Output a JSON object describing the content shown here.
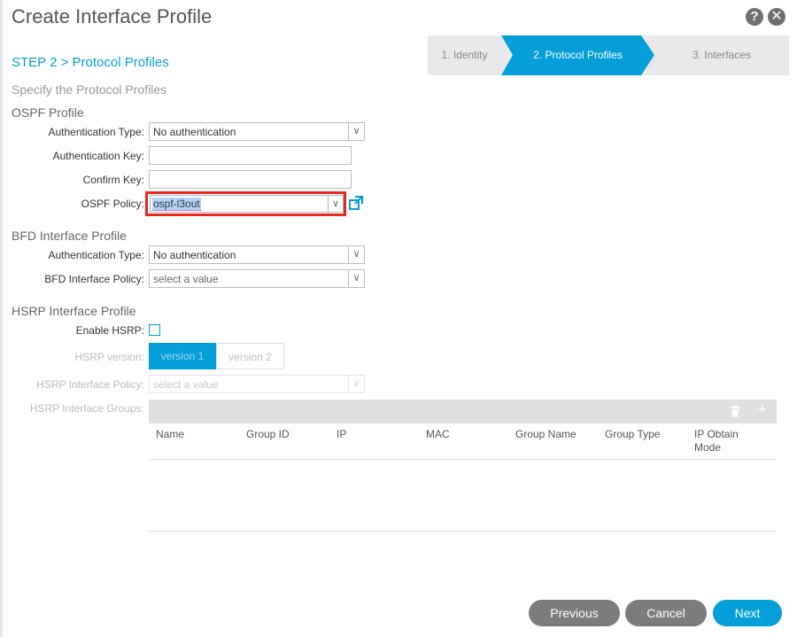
{
  "dialog": {
    "title": "Create Interface Profile",
    "help_label": "?",
    "close_label": "✕"
  },
  "wizard": {
    "steps": [
      {
        "label": "1. Identity",
        "state": "done"
      },
      {
        "label": "2. Protocol Profiles",
        "state": "active"
      },
      {
        "label": "3. Interfaces",
        "state": "pending"
      }
    ]
  },
  "step_heading": "STEP 2 > Protocol Profiles",
  "subheading": "Specify the Protocol Profiles",
  "ospf": {
    "section_title": "OSPF Profile",
    "auth_type_label": "Authentication Type:",
    "auth_type_value": "No authentication",
    "auth_key_label": "Authentication Key:",
    "auth_key_value": "",
    "confirm_key_label": "Confirm Key:",
    "confirm_key_value": "",
    "policy_label": "OSPF Policy:",
    "policy_value": "ospf-l3out"
  },
  "bfd": {
    "section_title": "BFD Interface Profile",
    "auth_type_label": "Authentication Type:",
    "auth_type_value": "No authentication",
    "policy_label": "BFD Interface Policy:",
    "policy_placeholder": "select a value"
  },
  "hsrp": {
    "section_title": "HSRP Interface Profile",
    "enable_label": "Enable HSRP:",
    "enabled": false,
    "version_label": "HSRP version:",
    "versions": [
      "version 1",
      "version 2"
    ],
    "selected_version": "version 1",
    "policy_label": "HSRP Interface Policy:",
    "policy_placeholder": "select a value",
    "groups_label": "HSRP Interface Groups:",
    "table_columns": [
      "Name",
      "Group ID",
      "IP",
      "MAC",
      "Group Name",
      "Group Type",
      "IP Obtain Mode"
    ],
    "table_rows": []
  },
  "footer": {
    "previous_label": "Previous",
    "cancel_label": "Cancel",
    "next_label": "Next"
  },
  "colors": {
    "accent": "#049fd9",
    "highlight_border": "#e8291c",
    "neutral_button": "#7c7c7c"
  }
}
